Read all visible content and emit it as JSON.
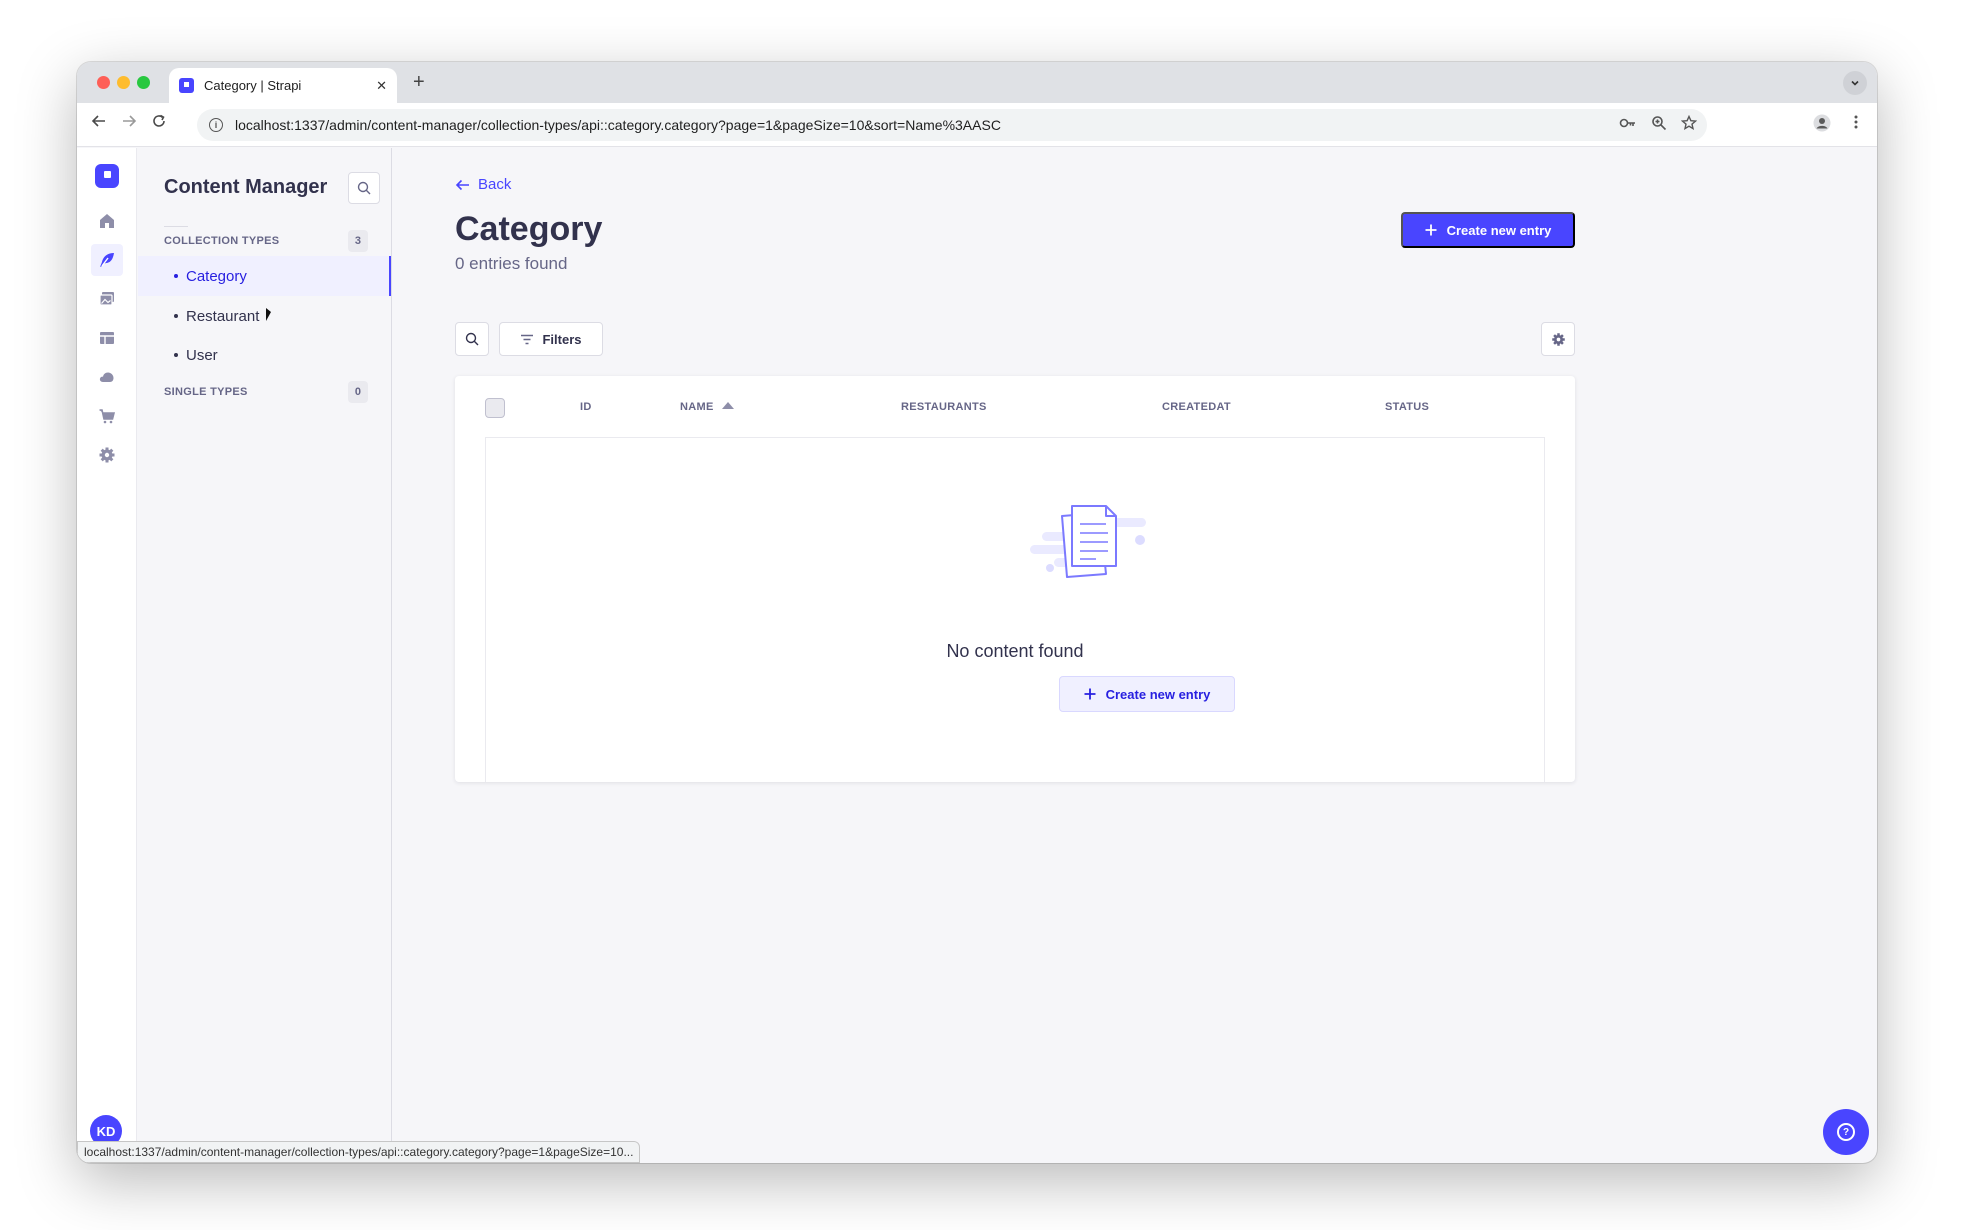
{
  "browser": {
    "tab_title": "Category | Strapi",
    "tab_close": "✕",
    "new_tab": "+",
    "url": "localhost:1337/admin/content-manager/collection-types/api::category.category?page=1&pageSize=10&sort=Name%3AASC",
    "status_url": "localhost:1337/admin/content-manager/collection-types/api::category.category?page=1&pageSize=10..."
  },
  "rail": {
    "avatar_initials": "KD",
    "icons": [
      "home-icon",
      "content-manager-icon",
      "media-library-icon",
      "content-type-builder-icon",
      "cloud-icon",
      "marketplace-icon",
      "settings-icon"
    ]
  },
  "sidebar": {
    "title": "Content Manager",
    "collection_types": {
      "label": "COLLECTION TYPES",
      "count": "3",
      "items": [
        {
          "label": "Category",
          "active": true
        },
        {
          "label": "Restaurant",
          "active": false
        },
        {
          "label": "User",
          "active": false
        }
      ]
    },
    "single_types": {
      "label": "SINGLE TYPES",
      "count": "0"
    }
  },
  "main": {
    "back_label": "Back",
    "title": "Category",
    "subtitle": "0 entries found",
    "create_label": "Create new entry",
    "filters_label": "Filters",
    "table": {
      "columns": [
        "ID",
        "NAME",
        "RESTAURANTS",
        "CREATEDAT",
        "STATUS"
      ],
      "sorted_column": "NAME",
      "rows": []
    },
    "empty_text": "No content found",
    "empty_create_label": "Create new entry"
  },
  "colors": {
    "primary": "#4945ff",
    "primary_light": "#f0f0ff",
    "text": "#32324d",
    "muted": "#666687"
  }
}
